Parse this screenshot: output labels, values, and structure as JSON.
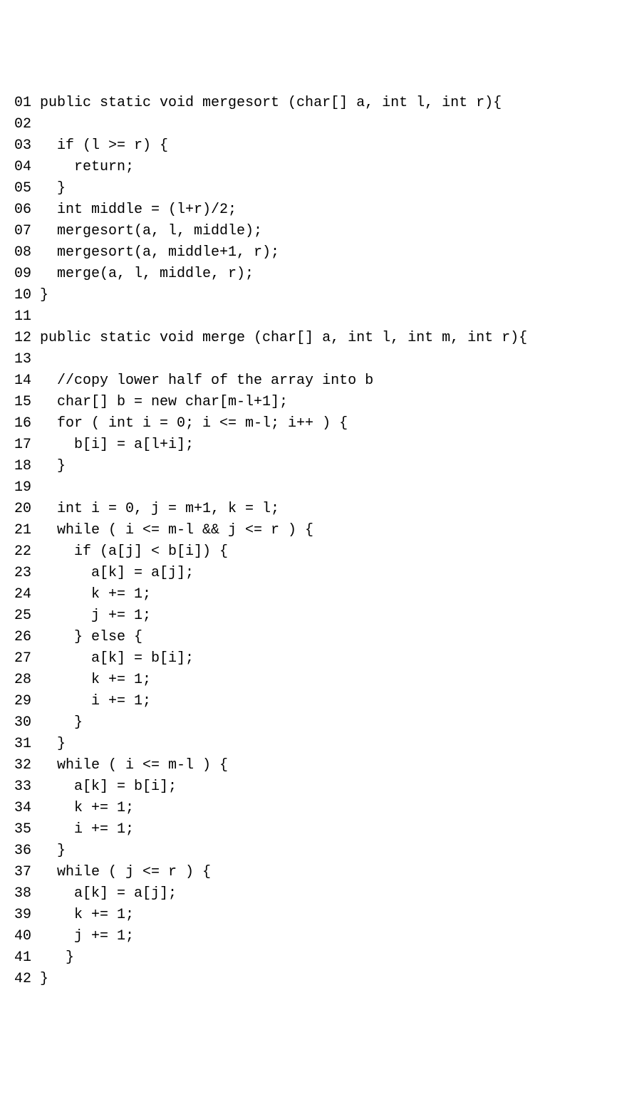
{
  "lines": [
    {
      "n": "01",
      "c": "public static void mergesort (char[] a, int l, int r){"
    },
    {
      "n": "02",
      "c": ""
    },
    {
      "n": "03",
      "c": "  if (l >= r) {"
    },
    {
      "n": "04",
      "c": "    return;"
    },
    {
      "n": "05",
      "c": "  }"
    },
    {
      "n": "06",
      "c": "  int middle = (l+r)/2;"
    },
    {
      "n": "07",
      "c": "  mergesort(a, l, middle);"
    },
    {
      "n": "08",
      "c": "  mergesort(a, middle+1, r);"
    },
    {
      "n": "09",
      "c": "  merge(a, l, middle, r);"
    },
    {
      "n": "10",
      "c": "}"
    },
    {
      "n": "11",
      "c": ""
    },
    {
      "n": "12",
      "c": "public static void merge (char[] a, int l, int m, int r){"
    },
    {
      "n": "13",
      "c": ""
    },
    {
      "n": "14",
      "c": "  //copy lower half of the array into b"
    },
    {
      "n": "15",
      "c": "  char[] b = new char[m-l+1];"
    },
    {
      "n": "16",
      "c": "  for ( int i = 0; i <= m-l; i++ ) {"
    },
    {
      "n": "17",
      "c": "    b[i] = a[l+i];"
    },
    {
      "n": "18",
      "c": "  }"
    },
    {
      "n": "19",
      "c": ""
    },
    {
      "n": "20",
      "c": "  int i = 0, j = m+1, k = l;"
    },
    {
      "n": "21",
      "c": "  while ( i <= m-l && j <= r ) {"
    },
    {
      "n": "22",
      "c": "    if (a[j] < b[i]) {"
    },
    {
      "n": "23",
      "c": "      a[k] = a[j];"
    },
    {
      "n": "24",
      "c": "      k += 1;"
    },
    {
      "n": "25",
      "c": "      j += 1;"
    },
    {
      "n": "26",
      "c": "    } else {"
    },
    {
      "n": "27",
      "c": "      a[k] = b[i];"
    },
    {
      "n": "28",
      "c": "      k += 1;"
    },
    {
      "n": "29",
      "c": "      i += 1;"
    },
    {
      "n": "30",
      "c": "    }"
    },
    {
      "n": "31",
      "c": "  }"
    },
    {
      "n": "32",
      "c": "  while ( i <= m-l ) {"
    },
    {
      "n": "33",
      "c": "    a[k] = b[i];"
    },
    {
      "n": "34",
      "c": "    k += 1;"
    },
    {
      "n": "35",
      "c": "    i += 1;"
    },
    {
      "n": "36",
      "c": "  }"
    },
    {
      "n": "37",
      "c": "  while ( j <= r ) {"
    },
    {
      "n": "38",
      "c": "    a[k] = a[j];"
    },
    {
      "n": "39",
      "c": "    k += 1;"
    },
    {
      "n": "40",
      "c": "    j += 1;"
    },
    {
      "n": "41",
      "c": "   }"
    },
    {
      "n": "42",
      "c": "}"
    }
  ]
}
